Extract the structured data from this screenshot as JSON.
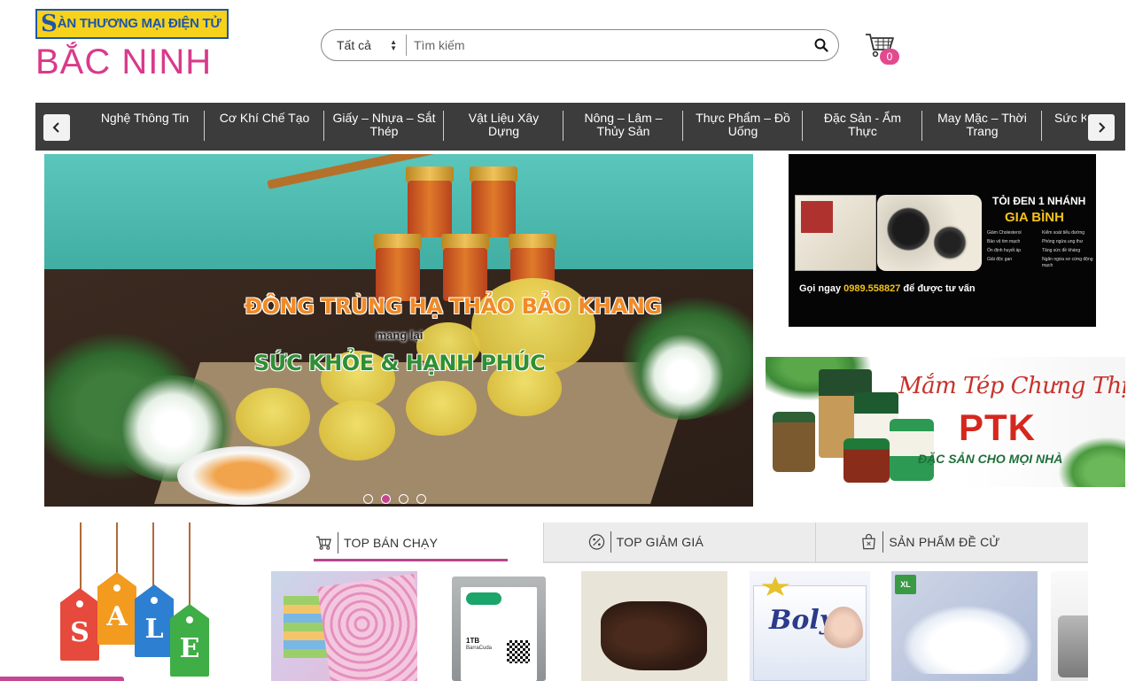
{
  "logo": {
    "top_s": "S",
    "top_rest": "ÀN THƯƠNG MẠI ĐIỆN TỬ",
    "bottom": "BẮC NINH"
  },
  "search": {
    "category": "Tất cả",
    "placeholder": "Tìm kiếm",
    "value": ""
  },
  "cart": {
    "count": "0"
  },
  "categories": [
    "Nghệ Thông Tin",
    "Cơ Khí Chế Tạo",
    "Giấy – Nhựa – Sắt Thép",
    "Vật Liệu Xây Dựng",
    "Nông – Lâm – Thủy Sản",
    "Thực Phẩm – Đồ Uống",
    "Đặc Sản - Ẩm Thực",
    "May Mặc – Thời Trang",
    "Sức Kl"
  ],
  "hero": {
    "title": "ĐÔNG TRÙNG HẠ THẢO BẢO KHANG",
    "sub": "mang lại",
    "tagline": "SỨC KHỎE & HẠNH PHÚC",
    "slide_count": 4,
    "active_slide": 2
  },
  "garlic_banner": {
    "title": "TỎI ĐEN 1 NHÁNH",
    "brand": "GIA BÌNH",
    "benefits": [
      "Giảm Cholesterol",
      "Kiểm soát tiểu đường",
      "Bảo vệ tim mạch",
      "Phòng ngừa ung thư",
      "Ổn định huyết áp",
      "Tăng sức đề kháng",
      "Giải độc gan",
      "Ngăn ngừa xơ cứng động mạch"
    ],
    "call_prefix": "Gọi ngay",
    "phone": "0989.558827",
    "call_suffix": "để được tư vấn"
  },
  "shrimp_banner": {
    "title": "Mắm Tép Chưng Thịt",
    "brand": "PTK",
    "tagline": "ĐẶC SẢN CHO MỌI NHÀ"
  },
  "sale_tags": {
    "letters": [
      "S",
      "A",
      "L",
      "E"
    ],
    "colors": [
      "#e64a3c",
      "#f39b1f",
      "#2d7fd1",
      "#3fae46"
    ]
  },
  "tabs": [
    {
      "label": "TOP BÁN CHẠY",
      "icon": "cart-icon",
      "active": true
    },
    {
      "label": "TOP GIẢM GIÁ",
      "icon": "discount-icon",
      "active": false
    },
    {
      "label": "SẢN PHẨM ĐỀ CỬ",
      "icon": "bag-icon",
      "active": false
    }
  ],
  "products": {
    "hdd_capacity": "1TB",
    "hdd_model": "BarraCuda",
    "diaper_brand": "Boly",
    "shoe_logo": "XL"
  },
  "colors": {
    "accent": "#c64690",
    "nav_bg": "#3c3c3c",
    "logo_pink": "#d93a8b",
    "logo_blue": "#1f56a8",
    "logo_yellow": "#f6d21c"
  }
}
